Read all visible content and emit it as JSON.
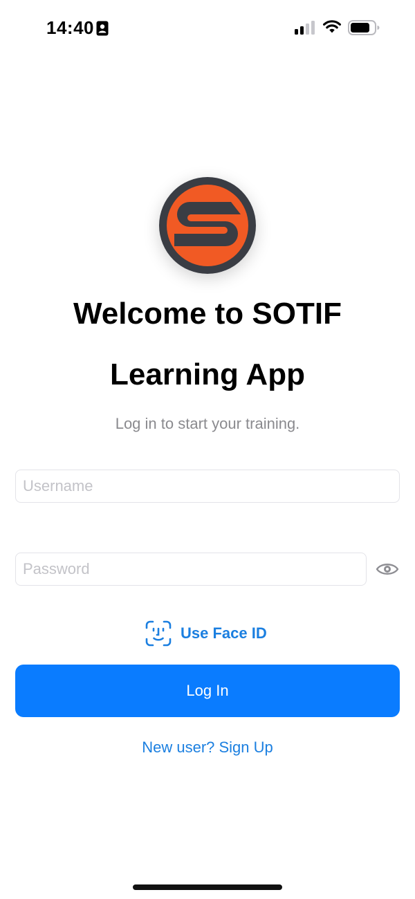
{
  "status_bar": {
    "time": "14:40",
    "icons": [
      "contact-card-icon",
      "signal-icon",
      "wifi-icon",
      "battery-icon"
    ]
  },
  "logo": {
    "letter": "S",
    "ring_color": "#3a3d44",
    "fill_color": "#f15a24"
  },
  "welcome": {
    "title_line_1": "Welcome to SOTIF",
    "title_line_2": "Learning App",
    "subtitle": "Log in to start your training."
  },
  "form": {
    "username_placeholder": "Username",
    "username_value": "",
    "password_placeholder": "Password",
    "password_value": "",
    "show_password_icon": "eye-icon"
  },
  "face_id": {
    "icon": "face-id-icon",
    "label": "Use Face ID"
  },
  "login": {
    "label": "Log In"
  },
  "signup": {
    "label": "New user? Sign Up"
  },
  "colors": {
    "accent": "#0a7cff",
    "link": "#1b7fe0",
    "subtitle": "#8a8a8e"
  }
}
